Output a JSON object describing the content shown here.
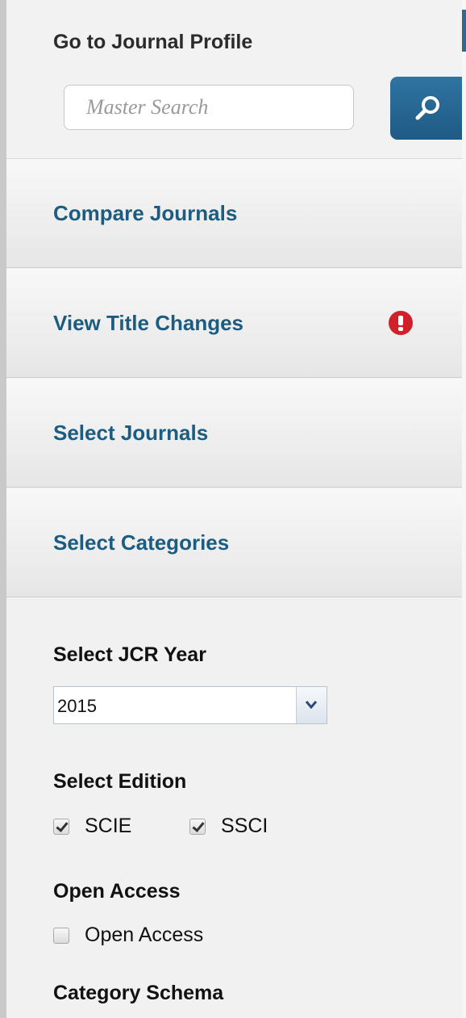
{
  "profile": {
    "title": "Go to Journal Profile",
    "search_placeholder": "Master Search"
  },
  "nav": {
    "compare": "Compare Journals",
    "title_changes": "View Title Changes",
    "select_journals": "Select Journals",
    "select_categories": "Select Categories"
  },
  "filters": {
    "jcr_year_heading": "Select JCR Year",
    "jcr_year_value": "2015",
    "edition_heading": "Select Edition",
    "editions": [
      {
        "label": "SCIE",
        "checked": true
      },
      {
        "label": "SSCI",
        "checked": true
      }
    ],
    "open_access_heading": "Open Access",
    "open_access_option": {
      "label": "Open Access",
      "checked": false
    },
    "category_schema_heading": "Category Schema"
  },
  "colors": {
    "nav_link": "#1b5c80",
    "search_button": "#2a6a98",
    "alert": "#d0202a"
  },
  "icons": {
    "search": "magnifier-icon",
    "alert": "exclamation-circle-icon",
    "dropdown": "chevron-down-icon"
  }
}
